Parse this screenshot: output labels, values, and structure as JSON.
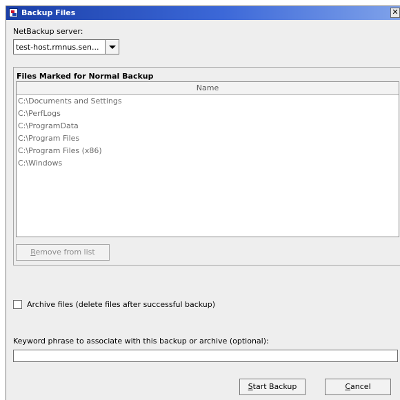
{
  "window": {
    "title": "Backup Files",
    "close_glyph": "✕"
  },
  "server": {
    "label": "NetBackup server:",
    "selected": "test-host.rmnus.sen..."
  },
  "files_group": {
    "title": "Files Marked for Normal Backup",
    "column_header": "Name",
    "rows": [
      "C:\\Documents and Settings",
      "C:\\PerfLogs",
      "C:\\ProgramData",
      "C:\\Program Files",
      "C:\\Program Files (x86)",
      "C:\\Windows"
    ],
    "remove_button": {
      "mnemonic": "R",
      "rest": "emove from list"
    }
  },
  "archive": {
    "label": "Archive files (delete files after successful backup)",
    "checked": false
  },
  "keyword": {
    "label": "Keyword phrase to associate with this backup or archive (optional):",
    "value": ""
  },
  "actions": {
    "start_button": {
      "mnemonic": "S",
      "rest": "tart Backup"
    },
    "cancel_button": {
      "mnemonic": "C",
      "rest": "ancel"
    }
  },
  "icons": {
    "app": "backup-app-icon",
    "dropdown": "chevron-down-icon",
    "close": "close-icon"
  }
}
